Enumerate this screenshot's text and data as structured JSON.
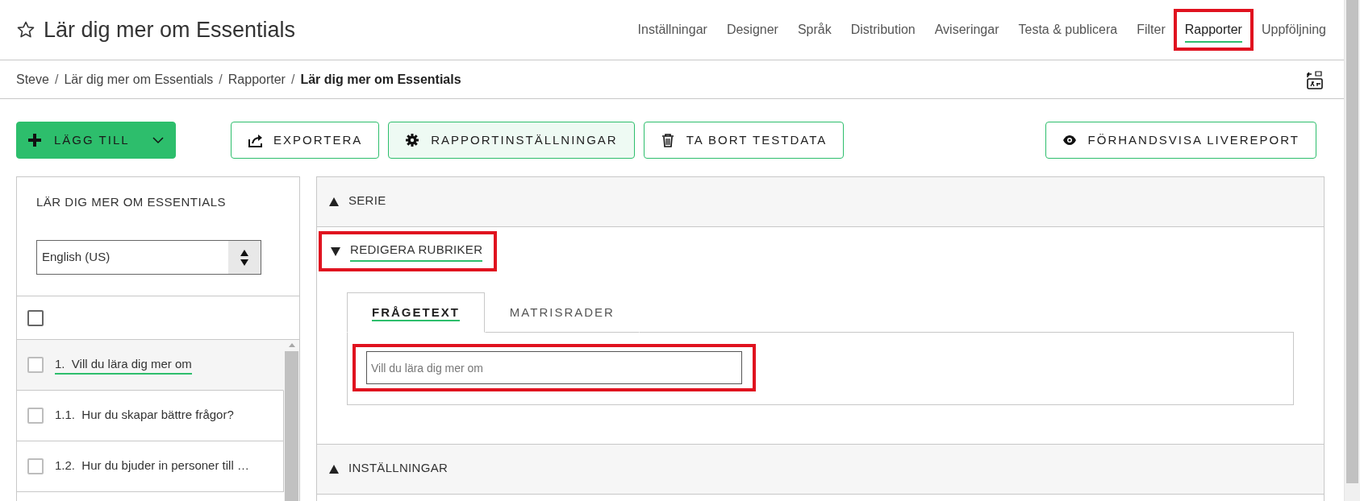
{
  "header": {
    "starred": false,
    "title": "Lär dig mer om Essentials"
  },
  "nav": [
    {
      "label": "Inställningar",
      "selected": false,
      "highlighted": false
    },
    {
      "label": "Designer",
      "selected": false,
      "highlighted": false
    },
    {
      "label": "Språk",
      "selected": false,
      "highlighted": false
    },
    {
      "label": "Distribution",
      "selected": false,
      "highlighted": false
    },
    {
      "label": "Aviseringar",
      "selected": false,
      "highlighted": false
    },
    {
      "label": "Testa & publicera",
      "selected": false,
      "highlighted": false
    },
    {
      "label": "Filter",
      "selected": false,
      "highlighted": false
    },
    {
      "label": "Rapporter",
      "selected": true,
      "highlighted": true
    },
    {
      "label": "Uppföljning",
      "selected": false,
      "highlighted": false
    }
  ],
  "breadcrumb": [
    {
      "label": "Steve",
      "current": false
    },
    {
      "separator": "/",
      "label": "Lär dig mer om Essentials",
      "current": false
    },
    {
      "separator": "/",
      "label": "Rapporter",
      "current": false
    },
    {
      "separator": "/",
      "label": "Lär dig mer om Essentials",
      "current": true
    }
  ],
  "toolbar": [
    {
      "label": "LÄGG TILL",
      "kind": "add"
    },
    {
      "label": "EXPORTERA",
      "kind": "export"
    },
    {
      "label": "RAPPORTINSTÄLLNINGAR",
      "kind": "settings"
    },
    {
      "label": "TA BORT TESTDATA",
      "kind": "delete"
    },
    {
      "label": "FÖRHANDSVISA LIVEREPORT",
      "kind": "preview"
    }
  ],
  "sidebar": {
    "title": "LÄR DIG MER OM ESSENTIALS",
    "language": "English (US)",
    "select_all_checked": false,
    "questions": [
      {
        "label": "1.  Vill du lära dig mer om",
        "checked": false,
        "selected": true
      },
      {
        "label": "1.1.  Hur du skapar bättre frågor?",
        "checked": false,
        "selected": false
      },
      {
        "label": "1.2.  Hur du bjuder in personer till …",
        "checked": false,
        "selected": false
      }
    ]
  },
  "sections": [
    {
      "title": "SERIE",
      "expanded": false,
      "highlighted": false
    },
    {
      "title": "REDIGERA RUBRIKER",
      "expanded": true,
      "highlighted": true,
      "tabs": [
        {
          "label": "FRÅGETEXT",
          "selected": true
        },
        {
          "label": "MATRISRADER",
          "selected": false
        }
      ],
      "field": {
        "value": "Vill du lära dig mer om",
        "highlighted": true
      }
    },
    {
      "title": "INSTÄLLNINGAR",
      "expanded": false,
      "highlighted": false
    }
  ]
}
